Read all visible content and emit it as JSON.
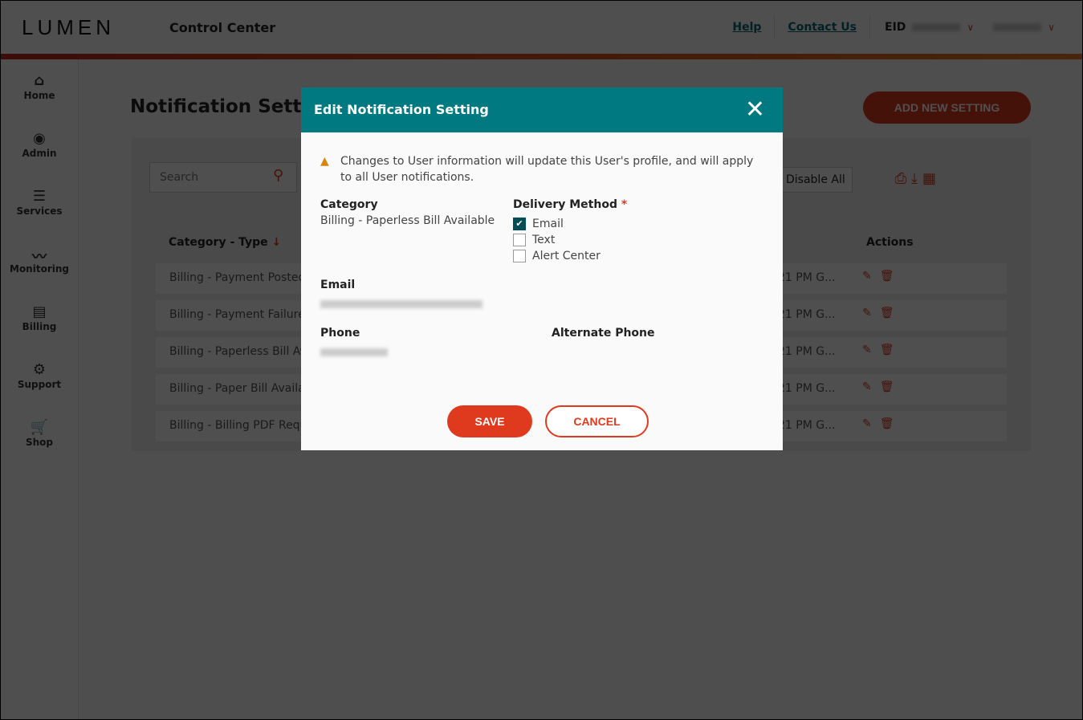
{
  "header": {
    "logo": "LUMEN",
    "app_title": "Control Center",
    "help": "Help",
    "contact": "Contact Us",
    "eid_label": "EID"
  },
  "sidebar": {
    "items": [
      {
        "label": "Home",
        "icon": "⌂"
      },
      {
        "label": "Admin",
        "icon": "◉"
      },
      {
        "label": "Services",
        "icon": "☰"
      },
      {
        "label": "Monitoring",
        "icon": "〰"
      },
      {
        "label": "Billing",
        "icon": "▤"
      },
      {
        "label": "Support",
        "icon": "⚙"
      },
      {
        "label": "Shop",
        "icon": "🛒"
      }
    ]
  },
  "main": {
    "title": "Notification Settings",
    "add_button": "ADD NEW SETTING",
    "search_placeholder": "Search",
    "disable_all": "Disable All",
    "columns": {
      "category": "Category - Type",
      "actions": "Actions"
    },
    "rows": [
      {
        "category": "Billing - Payment Posted",
        "time": "21 PM G..."
      },
      {
        "category": "Billing - Payment Failure",
        "time": "21 PM G..."
      },
      {
        "category": "Billing - Paperless Bill Available",
        "time": "21 PM G..."
      },
      {
        "category": "Billing - Paper Bill Available",
        "time": "21 PM G..."
      },
      {
        "category": "Billing - Billing PDF Request",
        "time": "21 PM G..."
      }
    ]
  },
  "modal": {
    "title": "Edit Notification Setting",
    "warning": "Changes to User information will update this User's profile, and will apply to all User notifications.",
    "category_label": "Category",
    "category_value": "Billing - Paperless Bill Available",
    "delivery_label": "Delivery Method",
    "required_mark": "*",
    "options": [
      {
        "label": "Email",
        "checked": true
      },
      {
        "label": "Text",
        "checked": false
      },
      {
        "label": "Alert Center",
        "checked": false
      }
    ],
    "email_label": "Email",
    "phone_label": "Phone",
    "alt_phone_label": "Alternate Phone",
    "save": "SAVE",
    "cancel": "CANCEL"
  }
}
